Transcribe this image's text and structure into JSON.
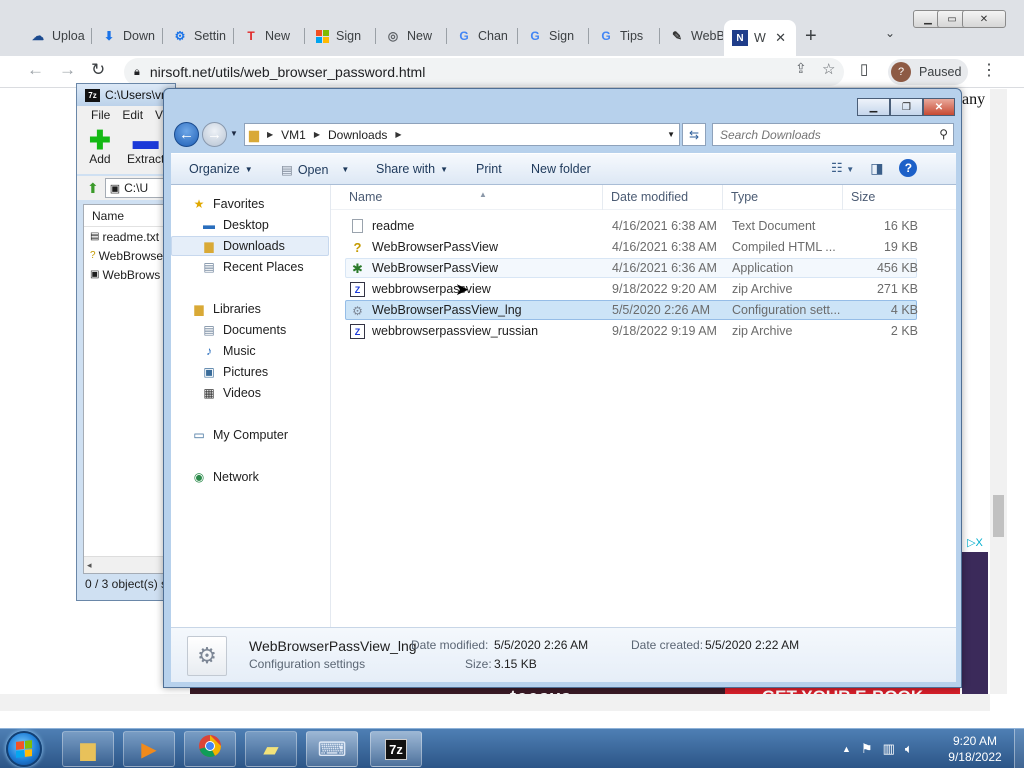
{
  "chrome": {
    "tabs": [
      {
        "label": "Uploa",
        "icon": "cloud-upload-icon"
      },
      {
        "label": "Down",
        "icon": "download-icon"
      },
      {
        "label": "Settin",
        "icon": "gear-icon"
      },
      {
        "label": "New",
        "icon": "flipboard-icon"
      },
      {
        "label": "Sign",
        "icon": "microsoft-icon"
      },
      {
        "label": "New",
        "icon": "chrome-icon"
      },
      {
        "label": "Chan",
        "icon": "google-icon"
      },
      {
        "label": "Sign",
        "icon": "google-icon"
      },
      {
        "label": "Tips",
        "icon": "google-icon"
      },
      {
        "label": "WebB",
        "icon": "usb-icon"
      },
      {
        "label": "W",
        "icon": "nirsoft-icon"
      }
    ],
    "new_tab_label": "+",
    "url": "nirsoft.net/utils/web_browser_password.html",
    "profile_initial": "?",
    "profile_label": "Paused",
    "page_snippet": "any",
    "ad_text_left": "teesys",
    "ad_text_right": "GET YOUR E-BOOK",
    "ad_close": "▷X"
  },
  "sevenzip": {
    "title": "C:\\Users\\vm",
    "app_icon_text": "7z",
    "menu": [
      "File",
      "Edit",
      "Vi"
    ],
    "add_label": "Add",
    "extract_label": "Extract",
    "path_text": "C:\\U",
    "column_name": "Name",
    "files": [
      "readme.txt",
      "WebBrowse",
      "WebBrows"
    ],
    "status": "0 / 3 object(s) s"
  },
  "explorer": {
    "breadcrumb": [
      "VM1",
      "Downloads"
    ],
    "search_placeholder": "Search Downloads",
    "commands": {
      "organize": "Organize",
      "open": "Open",
      "share_with": "Share with",
      "print": "Print",
      "new_folder": "New folder"
    },
    "nav": {
      "favorites": "Favorites",
      "desktop": "Desktop",
      "downloads": "Downloads",
      "recent_places": "Recent Places",
      "libraries": "Libraries",
      "documents": "Documents",
      "music": "Music",
      "pictures": "Pictures",
      "videos": "Videos",
      "my_computer": "My Computer",
      "network": "Network"
    },
    "columns": {
      "name": "Name",
      "date": "Date modified",
      "type": "Type",
      "size": "Size"
    },
    "files": [
      {
        "name": "readme",
        "date": "4/16/2021 6:38 AM",
        "type": "Text Document",
        "size": "16 KB",
        "icon": "text-file-icon"
      },
      {
        "name": "WebBrowserPassView",
        "date": "4/16/2021 6:38 AM",
        "type": "Compiled HTML ...",
        "size": "19 KB",
        "icon": "chm-help-icon"
      },
      {
        "name": "WebBrowserPassView",
        "date": "4/16/2021 6:36 AM",
        "type": "Application",
        "size": "456 KB",
        "icon": "application-icon"
      },
      {
        "name": "webbrowserpassview",
        "date": "9/18/2022 9:20 AM",
        "type": "zip Archive",
        "size": "271 KB",
        "icon": "zip-archive-icon"
      },
      {
        "name": "WebBrowserPassView_lng",
        "date": "5/5/2020 2:26 AM",
        "type": "Configuration sett...",
        "size": "4 KB",
        "icon": "config-file-icon"
      },
      {
        "name": "webbrowserpassview_russian",
        "date": "9/18/2022 9:19 AM",
        "type": "zip Archive",
        "size": "2 KB",
        "icon": "zip-archive-icon"
      }
    ],
    "details": {
      "name": "WebBrowserPassView_lng",
      "type": "Configuration settings",
      "modified_label": "Date modified:",
      "modified_value": "5/5/2020 2:26 AM",
      "created_label": "Date created:",
      "created_value": "5/5/2020 2:22 AM",
      "size_label": "Size:",
      "size_value": "3.15 KB"
    }
  },
  "taskbar": {
    "sevenzip_label": "7z",
    "clock_time": "9:20 AM",
    "clock_date": "9/18/2022"
  },
  "colors": {
    "selection": "#cce4f7",
    "explorer_frame": "#b7d1ec",
    "taskbar": "#2c5587",
    "start_orb": "#1e7ed8"
  }
}
